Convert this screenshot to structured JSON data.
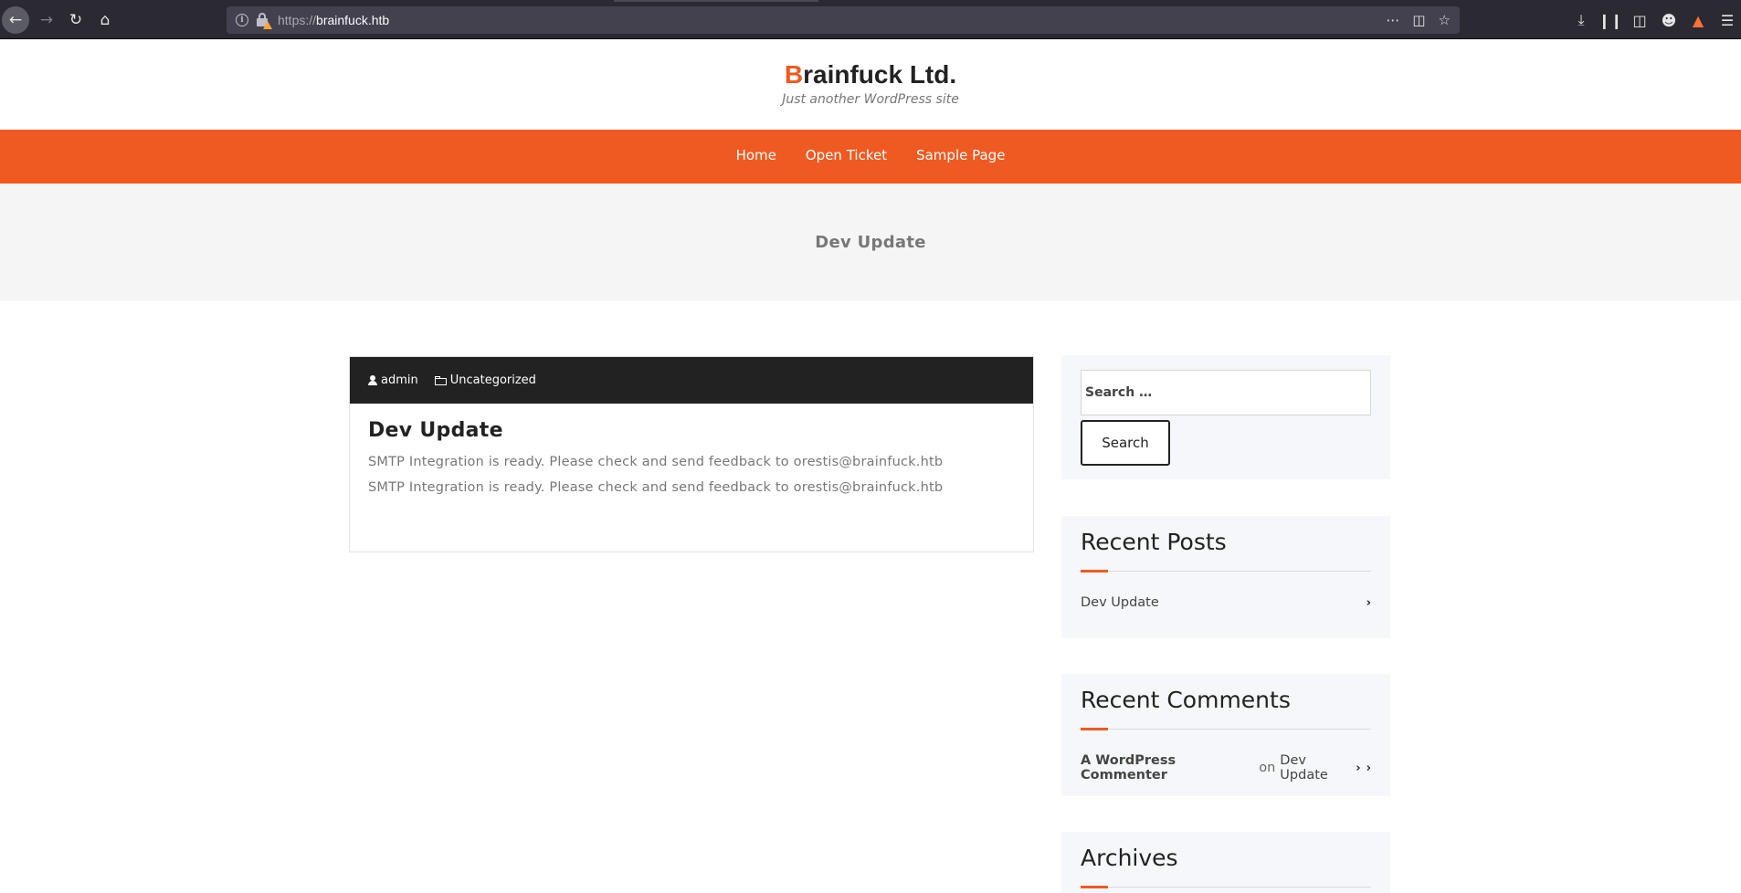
{
  "browser": {
    "url_scheme": "https://",
    "url_host": "brainfuck.htb"
  },
  "site": {
    "title_first": "B",
    "title_rest": "rainfuck Ltd.",
    "tagline": "Just another WordPress site"
  },
  "nav": {
    "items": [
      {
        "label": "Home"
      },
      {
        "label": "Open Ticket"
      },
      {
        "label": "Sample Page"
      }
    ]
  },
  "page": {
    "title": "Dev Update"
  },
  "post": {
    "author": "admin",
    "category": "Uncategorized",
    "title": "Dev Update",
    "paragraphs": [
      "SMTP Integration is ready. Please check and send feedback to orestis@brainfuck.htb",
      "SMTP Integration is ready. Please check and send feedback to orestis@brainfuck.htb"
    ]
  },
  "sidebar": {
    "search": {
      "placeholder": "Search …",
      "button_label": "Search"
    },
    "recent_posts": {
      "title": "Recent Posts",
      "items": [
        {
          "label": "Dev Update"
        }
      ]
    },
    "recent_comments": {
      "title": "Recent Comments",
      "items": [
        {
          "author": "A WordPress Commenter",
          "on": "on",
          "post": "Dev Update"
        }
      ]
    },
    "archives": {
      "title": "Archives"
    }
  },
  "colors": {
    "accent": "#ef5a22",
    "dark": "#222222",
    "band": "#f5f5f5",
    "widget_bg": "#f6f7fb"
  }
}
